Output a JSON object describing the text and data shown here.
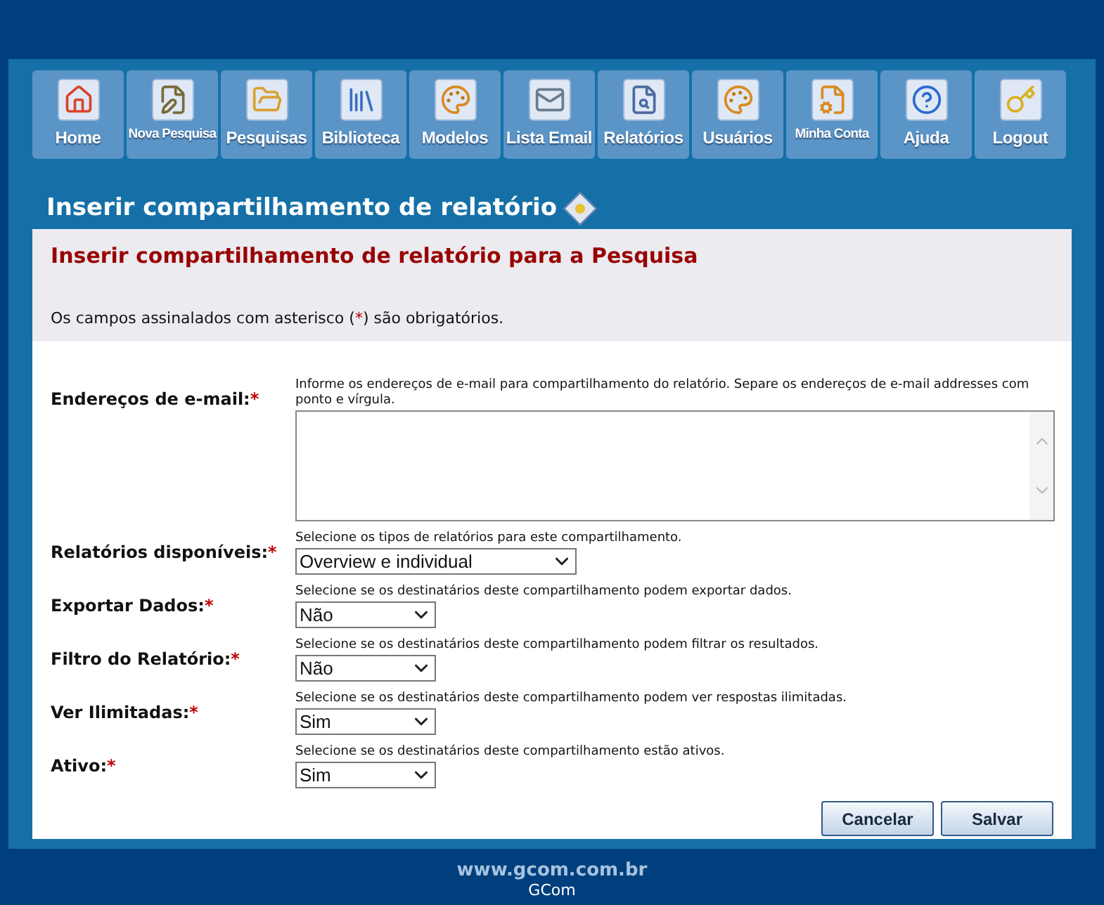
{
  "nav": [
    {
      "label": "Home"
    },
    {
      "label": "Nova Pesquisa"
    },
    {
      "label": "Pesquisas"
    },
    {
      "label": "Biblioteca"
    },
    {
      "label": "Modelos"
    },
    {
      "label": "Lista Email"
    },
    {
      "label": "Relatórios"
    },
    {
      "label": "Usuários"
    },
    {
      "label": "Minha Conta"
    },
    {
      "label": "Ajuda"
    },
    {
      "label": "Logout"
    }
  ],
  "page_title": "Inserir compartilhamento de relatório",
  "form": {
    "title": "Inserir compartilhamento de relatório para a Pesquisa",
    "note": {
      "before": "Os campos assinalados com asterisco (",
      "mark": "*",
      "after": ") são obrigatórios."
    },
    "fields": [
      {
        "kind": "textarea",
        "label": "Endereços de e-mail:",
        "required_mark": "*",
        "hint": "Informe os endereços de e-mail para compartilhamento do relatório. Separe os endereços de e-mail addresses com ponto e vírgula."
      },
      {
        "kind": "select",
        "label": "Relatórios disponíveis:",
        "required_mark": "*",
        "hint": "Selecione os tipos de relatórios para este compartilhamento.",
        "value": "Overview e individual"
      },
      {
        "kind": "select",
        "label": "Exportar Dados:",
        "required_mark": "*",
        "hint": "Selecione se os destinatários deste compartilhamento podem exportar dados.",
        "value": "Não"
      },
      {
        "kind": "select",
        "label": "Filtro do Relatório:",
        "required_mark": "*",
        "hint": "Selecione se os destinatários deste compartilhamento podem filtrar os resultados.",
        "value": "Não"
      },
      {
        "kind": "select",
        "label": "Ver Ilimitadas:",
        "required_mark": "*",
        "hint": "Selecione se os destinatários deste compartilhamento podem ver respostas ilimitadas.",
        "value": "Sim"
      },
      {
        "kind": "select",
        "label": "Ativo:",
        "required_mark": "*",
        "hint": "Selecione se os destinatários deste compartilhamento estão ativos.",
        "value": "Sim"
      }
    ],
    "buttons": [
      "Cancelar",
      "Salvar"
    ]
  },
  "footer": {
    "url": "www.gcom.com.br",
    "name": "GCom"
  }
}
